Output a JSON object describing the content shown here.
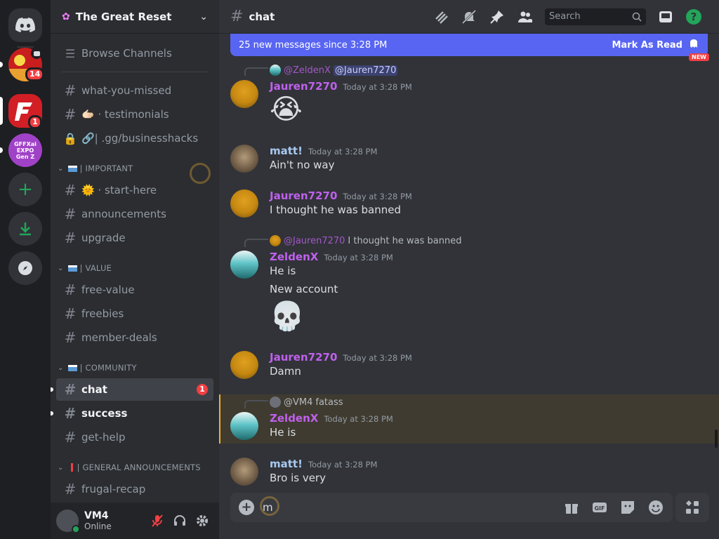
{
  "server": {
    "name": "The Great Reset",
    "browse_label": "Browse Channels"
  },
  "rail": {
    "server1_badge": "14",
    "server2_badge": "1",
    "server3_label": "GFFXai EXPO Gen Z"
  },
  "channels": {
    "top": [
      {
        "label": "what-you-missed"
      },
      {
        "label": "🫱🏻 · testimonials"
      },
      {
        "label": "🔗| .gg/businesshacks"
      }
    ],
    "cat_important": "| IMPORTANT",
    "important": [
      {
        "label": "🌞 · start-here"
      },
      {
        "label": "announcements"
      },
      {
        "label": "upgrade"
      }
    ],
    "cat_value": "| VALUE",
    "value": [
      {
        "label": "free-value"
      },
      {
        "label": "freebies"
      },
      {
        "label": "member-deals"
      }
    ],
    "cat_community": "| COMMUNITY",
    "community": [
      {
        "label": "chat",
        "badge": "1"
      },
      {
        "label": "success"
      },
      {
        "label": "get-help"
      }
    ],
    "cat_general": "| GENERAL ANNOUNCEMENTS",
    "general": [
      {
        "label": "frugal-recap"
      }
    ]
  },
  "user": {
    "name": "VM4",
    "status": "Online"
  },
  "topbar": {
    "channel": "chat",
    "search_placeholder": "Search"
  },
  "new_bar": {
    "text": "25 new messages since 3:28 PM",
    "action": "Mark As Read",
    "tag": "NEW"
  },
  "messages": [
    {
      "reply_user": "@ZeldenX",
      "reply_mention": "@Jauren7270",
      "user": "Jauren7270",
      "time": "Today at 3:28 PM",
      "emoji": "😭"
    },
    {
      "user": "matt!",
      "time": "Today at 3:28 PM",
      "text": "Ain't no way"
    },
    {
      "user": "Jauren7270",
      "time": "Today at 3:28 PM",
      "text": "I thought he was banned"
    },
    {
      "reply_user": "@Jauren7270",
      "reply_text": "I thought he was banned",
      "user": "ZeldenX",
      "time": "Today at 3:28 PM",
      "text": "He is",
      "text2": "New account",
      "emoji": "💀"
    },
    {
      "user": "Jauren7270",
      "time": "Today at 3:28 PM",
      "text": "Damn"
    },
    {
      "reply_user": "@VM4",
      "reply_text": "fatass",
      "user": "ZeldenX",
      "time": "Today at 3:28 PM",
      "text": "He is"
    },
    {
      "user": "matt!",
      "time": "Today at 3:28 PM",
      "text": "Bro is very"
    }
  ],
  "composer": {
    "value": "m"
  },
  "colors": {
    "accent": "#5865f2",
    "danger": "#f23f43",
    "online": "#23a55a",
    "username_purple": "#c061ed"
  }
}
